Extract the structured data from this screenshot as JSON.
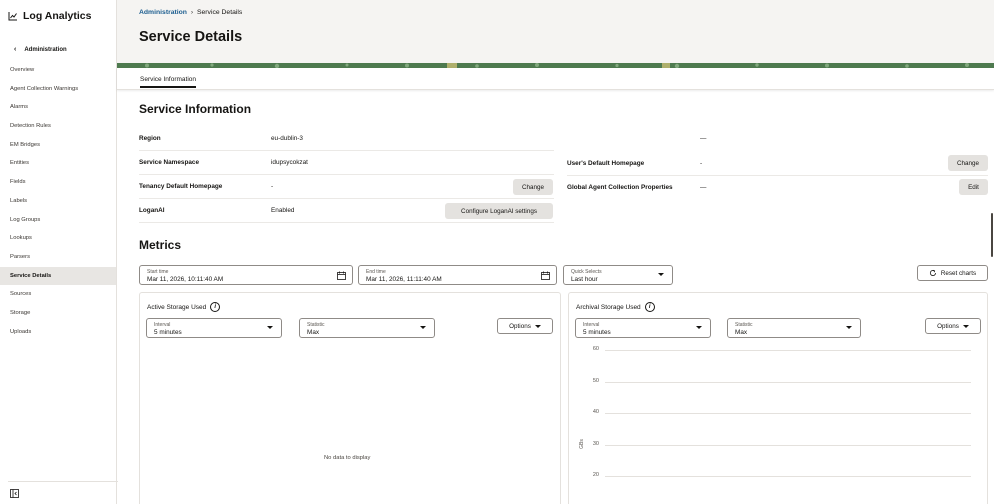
{
  "app": {
    "title": "Log Analytics"
  },
  "sidebar": {
    "back_label": "Administration",
    "items": [
      {
        "label": "Overview"
      },
      {
        "label": "Agent Collection Warnings"
      },
      {
        "label": "Alarms"
      },
      {
        "label": "Detection Rules"
      },
      {
        "label": "EM Bridges"
      },
      {
        "label": "Entities"
      },
      {
        "label": "Fields"
      },
      {
        "label": "Labels"
      },
      {
        "label": "Log Groups"
      },
      {
        "label": "Lookups"
      },
      {
        "label": "Parsers"
      },
      {
        "label": "Service Details",
        "active": true
      },
      {
        "label": "Sources"
      },
      {
        "label": "Storage"
      },
      {
        "label": "Uploads"
      }
    ]
  },
  "header": {
    "breadcrumb_parent": "Administration",
    "breadcrumb_sep": "›",
    "breadcrumb_current": "Service Details",
    "title": "Service Details"
  },
  "tabs": [
    {
      "label": "Service Information",
      "active": true
    }
  ],
  "service_info": {
    "title": "Service Information",
    "region_label": "Region",
    "region_value": "eu-dublin-3",
    "region_right_value": "—",
    "namespace_label": "Service Namespace",
    "namespace_value": "idupsycokzat",
    "tenancy_home_label": "Tenancy Default Homepage",
    "tenancy_home_value": "-",
    "tenancy_change_button": "Change",
    "user_home_label": "User's Default Homepage",
    "user_home_value": "-",
    "user_change_button": "Change",
    "loganai_label": "LoganAI",
    "loganai_value": "Enabled",
    "loganai_button": "Configure LoganAI settings",
    "global_agent_label": "Global Agent Collection Properties",
    "global_agent_value": "—",
    "global_agent_edit_button": "Edit"
  },
  "metrics": {
    "title": "Metrics",
    "start_time_label": "Start time",
    "start_time_value": "Mar 11, 2026, 10:11:40 AM",
    "end_time_label": "End time",
    "end_time_value": "Mar 11, 2026, 11:11:40 AM",
    "quick_selects_label": "Quick Selects",
    "quick_selects_value": "Last hour",
    "reset_button": "Reset charts",
    "info_glyph": "i"
  },
  "active_panel": {
    "title": "Active Storage Used",
    "interval_label": "Interval",
    "interval_value": "5 minutes",
    "statistic_label": "Statistic",
    "statistic_value": "Max",
    "options_button": "Options",
    "no_data": "No data to display"
  },
  "archival_panel": {
    "title": "Archival Storage Used",
    "interval_label": "Interval",
    "interval_value": "5 minutes",
    "statistic_label": "Statistic",
    "statistic_value": "Max",
    "options_button": "Options"
  },
  "chart_data": {
    "type": "line",
    "title": "Archival Storage Used",
    "ylabel": "GBs",
    "y_ticks": [
      "60",
      "50",
      "40",
      "30",
      "20"
    ],
    "ylim": [
      20,
      60
    ],
    "grid": true,
    "series": []
  },
  "colors": {
    "link": "#1b5d8f",
    "active_nav_bg": "#e8e6e3",
    "header_bg": "#f5f4f2",
    "button_bg": "#e4e2df",
    "decor_green": "#4e7a4f"
  }
}
